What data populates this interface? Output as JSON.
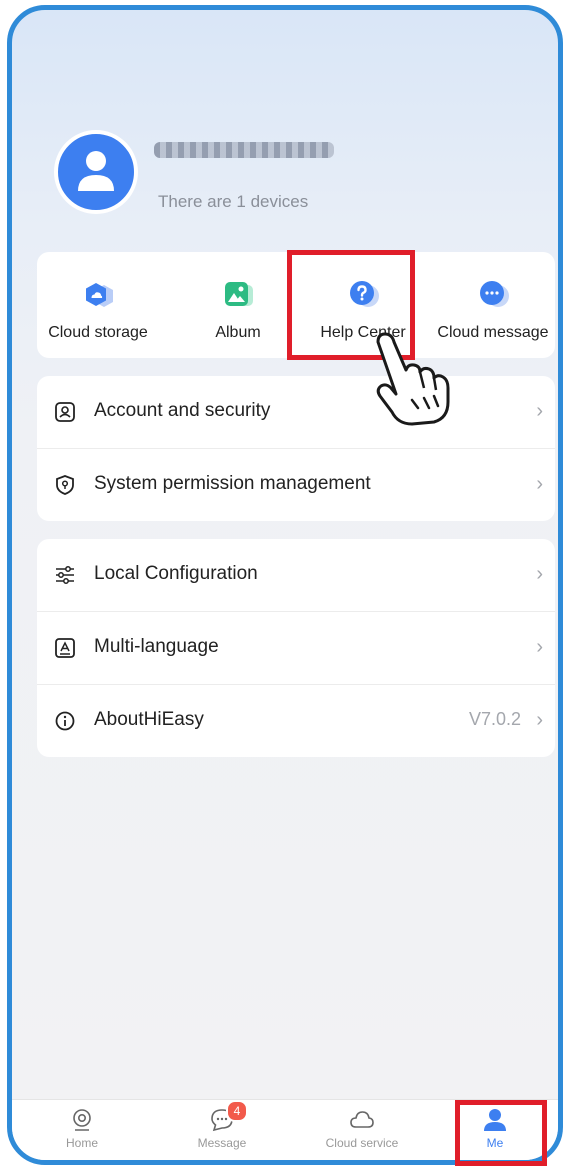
{
  "profile": {
    "device_count_text": "There are 1 devices"
  },
  "quick_actions": [
    {
      "label": "Cloud storage",
      "icon": "cloud-storage-icon"
    },
    {
      "label": "Album",
      "icon": "album-icon"
    },
    {
      "label": "Help Center",
      "icon": "help-icon"
    },
    {
      "label": "Cloud message",
      "icon": "chat-icon"
    }
  ],
  "settings_group_1": [
    {
      "label": "Account and security",
      "icon": "account-icon"
    },
    {
      "label": "System permission management",
      "icon": "shield-icon"
    }
  ],
  "settings_group_2": [
    {
      "label": "Local Configuration",
      "icon": "sliders-icon"
    },
    {
      "label": "Multi-language",
      "icon": "language-icon"
    },
    {
      "label": "AboutHiEasy",
      "icon": "info-icon",
      "value": "V7.0.2"
    }
  ],
  "tabbar": {
    "tabs": [
      {
        "label": "Home",
        "icon": "camera-icon"
      },
      {
        "label": "Message",
        "icon": "message-icon",
        "badge": "4"
      },
      {
        "label": "Cloud service",
        "icon": "cloud-icon"
      },
      {
        "label": "Me",
        "icon": "person-icon",
        "active": true
      }
    ]
  },
  "colors": {
    "accent": "#3d7ff0",
    "frame": "#2f8bd8",
    "highlight": "#e01e2a",
    "badge": "#f25a4b"
  }
}
